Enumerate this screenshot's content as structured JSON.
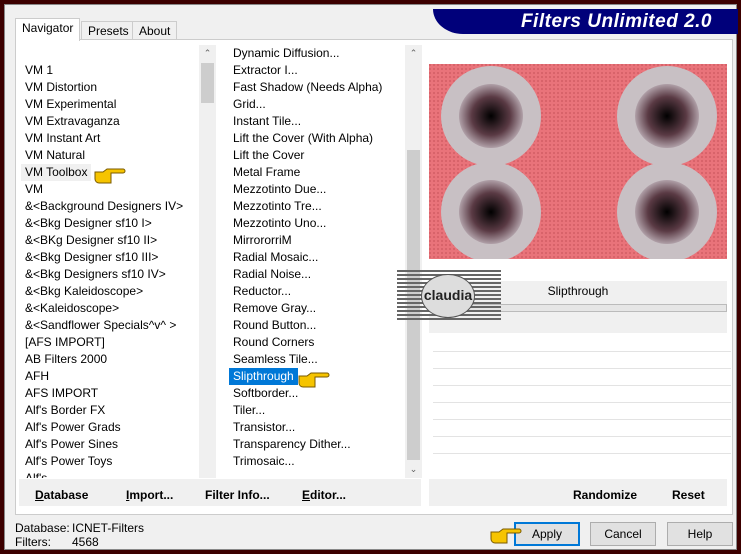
{
  "window": {
    "title": "Filters Unlimited 2.0"
  },
  "tabs": [
    {
      "label": "Navigator"
    },
    {
      "label": "Presets"
    },
    {
      "label": "About"
    }
  ],
  "categories": [
    "",
    "VM 1",
    "VM Distortion",
    "VM Experimental",
    "VM Extravaganza",
    "VM Instant Art",
    "VM Natural",
    "VM Toolbox",
    "VM",
    "&<Background Designers IV>",
    "&<Bkg Designer sf10 I>",
    "&<BKg Designer sf10 II>",
    "&<Bkg Designer sf10 III>",
    "&<Bkg Designers sf10 IV>",
    "&<Bkg Kaleidoscope>",
    "&<Kaleidoscope>",
    "&<Sandflower Specials^v^ >",
    "[AFS IMPORT]",
    "AB Filters 2000",
    "AFH",
    "AFS IMPORT",
    "Alf's Border FX",
    "Alf's Power Grads",
    "Alf's Power Sines",
    "Alf's Power Toys",
    "Alf's ..."
  ],
  "selected_category": "VM Toolbox",
  "filters": [
    "Dynamic Diffusion...",
    "Extractor I...",
    "Fast Shadow (Needs Alpha)",
    "Grid...",
    "Instant Tile...",
    "Lift the Cover (With Alpha)",
    "Lift the Cover",
    "Metal Frame",
    "Mezzotinto Due...",
    "Mezzotinto Tre...",
    "Mezzotinto Uno...",
    "MirrororriM",
    "Radial Mosaic...",
    "Radial Noise...",
    "Reductor...",
    "Remove Gray...",
    "Round Button...",
    "Round Corners",
    "Seamless Tile...",
    "Slipthrough",
    "Softborder...",
    "Tiler...",
    "Transistor...",
    "Transparency Dither...",
    "Trimosaic..."
  ],
  "selected_filter": "Slipthrough",
  "param_title": "Slipthrough",
  "watermark": "claudia",
  "left_buttons": [
    {
      "label": "Database",
      "u": "D"
    },
    {
      "label": "Import...",
      "u": "I"
    },
    {
      "label": "Filter Info...",
      "u": "I"
    },
    {
      "label": "Editor...",
      "u": "E"
    }
  ],
  "right_buttons": {
    "randomize": "Randomize",
    "reset": "Reset"
  },
  "status": {
    "db_label": "Database:",
    "db_value": "ICNET-Filters",
    "filters_label": "Filters:",
    "filters_value": "4568"
  },
  "dialog_buttons": {
    "apply": "Apply",
    "cancel": "Cancel",
    "help": "Help"
  },
  "colors": {
    "selection": "#0078d7",
    "banner": "#00007a",
    "preview_bg": "#e9737a",
    "frame": "#3c0000"
  }
}
